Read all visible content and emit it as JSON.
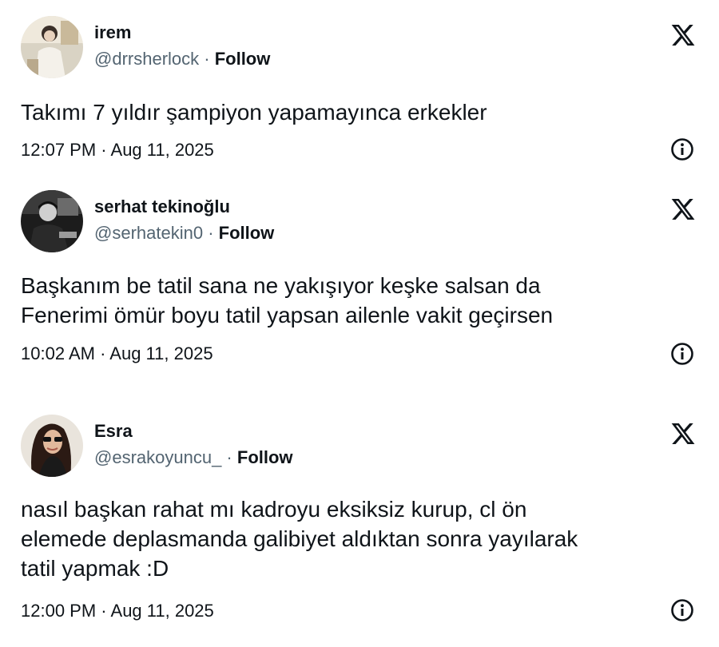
{
  "tweets": [
    {
      "name": "irem",
      "handle": "@drrsherlock",
      "separator": " · ",
      "follow_label": "Follow",
      "text_lines": [
        "Takımı 7 yıldır şampiyon yapamayınca erkekler"
      ],
      "time": "12:07 PM",
      "date": "Aug 11, 2025",
      "avatar_icon": "avatar-photo",
      "logo_icon": "x-logo-icon",
      "info_icon": "info-icon"
    },
    {
      "name": "serhat tekinoğlu",
      "handle": "@serhatekin0",
      "separator": " · ",
      "follow_label": "Follow",
      "text_lines": [
        "Başkanım be tatil sana ne yakışıyor keşke salsan da",
        "Fenerimi ömür boyu tatil yapsan ailenle vakit geçirsen"
      ],
      "time": "10:02 AM",
      "date": "Aug 11, 2025",
      "avatar_icon": "avatar-photo",
      "logo_icon": "x-logo-icon",
      "info_icon": "info-icon"
    },
    {
      "name": "Esra",
      "handle": "@esrakoyuncu_",
      "separator": " · ",
      "follow_label": "Follow",
      "text_lines": [
        "nasıl başkan rahat mı kadroyu eksiksiz kurup, cl ön",
        "elemede deplasmanda galibiyet aldıktan sonra yayılarak",
        "tatil yapmak :D"
      ],
      "time": "12:00 PM",
      "date": "Aug 11, 2025",
      "avatar_icon": "avatar-photo",
      "logo_icon": "x-logo-icon",
      "info_icon": "info-icon"
    }
  ],
  "meta_separator": " · ",
  "colors": {
    "text": "#0f1419",
    "secondary": "#536471",
    "background": "#ffffff"
  }
}
